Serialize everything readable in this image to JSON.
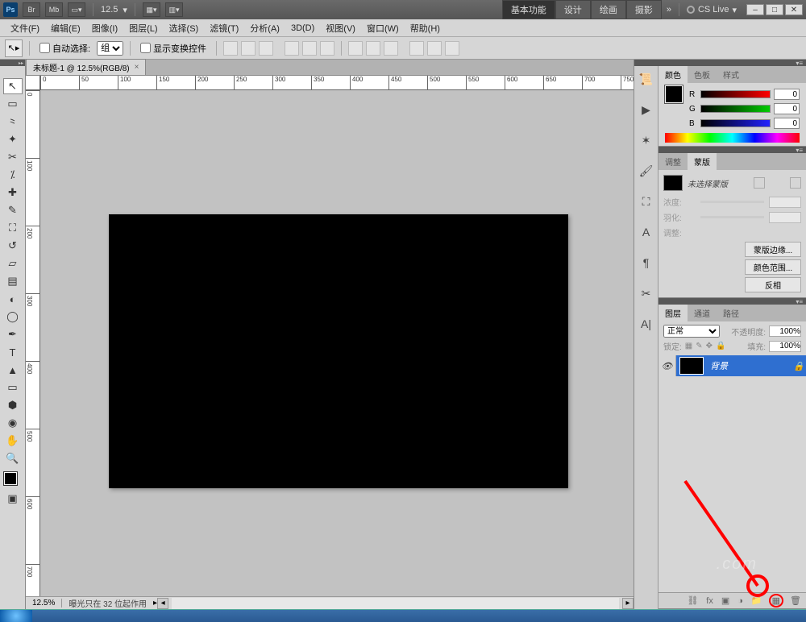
{
  "titlebar": {
    "zoom": "12.5",
    "workspaces": [
      "基本功能",
      "设计",
      "绘画",
      "摄影"
    ],
    "more": "»",
    "cslive": "CS Live"
  },
  "menu": {
    "items": [
      "文件(F)",
      "编辑(E)",
      "图像(I)",
      "图层(L)",
      "选择(S)",
      "滤镜(T)",
      "分析(A)",
      "3D(D)",
      "视图(V)",
      "窗口(W)",
      "帮助(H)"
    ]
  },
  "options": {
    "auto_select": "自动选择:",
    "group": "组",
    "show_controls": "显示变换控件"
  },
  "doc_tab": {
    "title": "未标题-1 @ 12.5%(RGB/8)",
    "close": "×"
  },
  "ruler_h": [
    "0",
    "50",
    "100",
    "150",
    "200",
    "250",
    "300",
    "350",
    "400",
    "450",
    "500",
    "550",
    "600",
    "650",
    "700",
    "750"
  ],
  "ruler_v": [
    "0",
    "100",
    "200",
    "300",
    "400",
    "500",
    "600",
    "700"
  ],
  "statusbar": {
    "zoom": "12.5%",
    "message": "曝光只在 32 位起作用"
  },
  "panels": {
    "color": {
      "tabs": [
        "颜色",
        "色板",
        "样式"
      ],
      "R": "R",
      "G": "G",
      "B": "B",
      "r_val": "0",
      "g_val": "0",
      "b_val": "0"
    },
    "adjust_mask": {
      "tabs": [
        "调整",
        "蒙版"
      ],
      "mask_none": "未选择蒙版",
      "density": "浓度:",
      "feather": "羽化:",
      "adjust": "调整:",
      "btn_edge": "蒙版边缘...",
      "btn_range": "颜色范围...",
      "btn_invert": "反相"
    },
    "layers": {
      "tabs": [
        "图层",
        "通道",
        "路径"
      ],
      "blend": "正常",
      "opacity_label": "不透明度:",
      "opacity_val": "100%",
      "lock_label": "锁定:",
      "fill_label": "填充:",
      "fill_val": "100%",
      "layer_name": "背景"
    }
  },
  "watermark": ".com"
}
